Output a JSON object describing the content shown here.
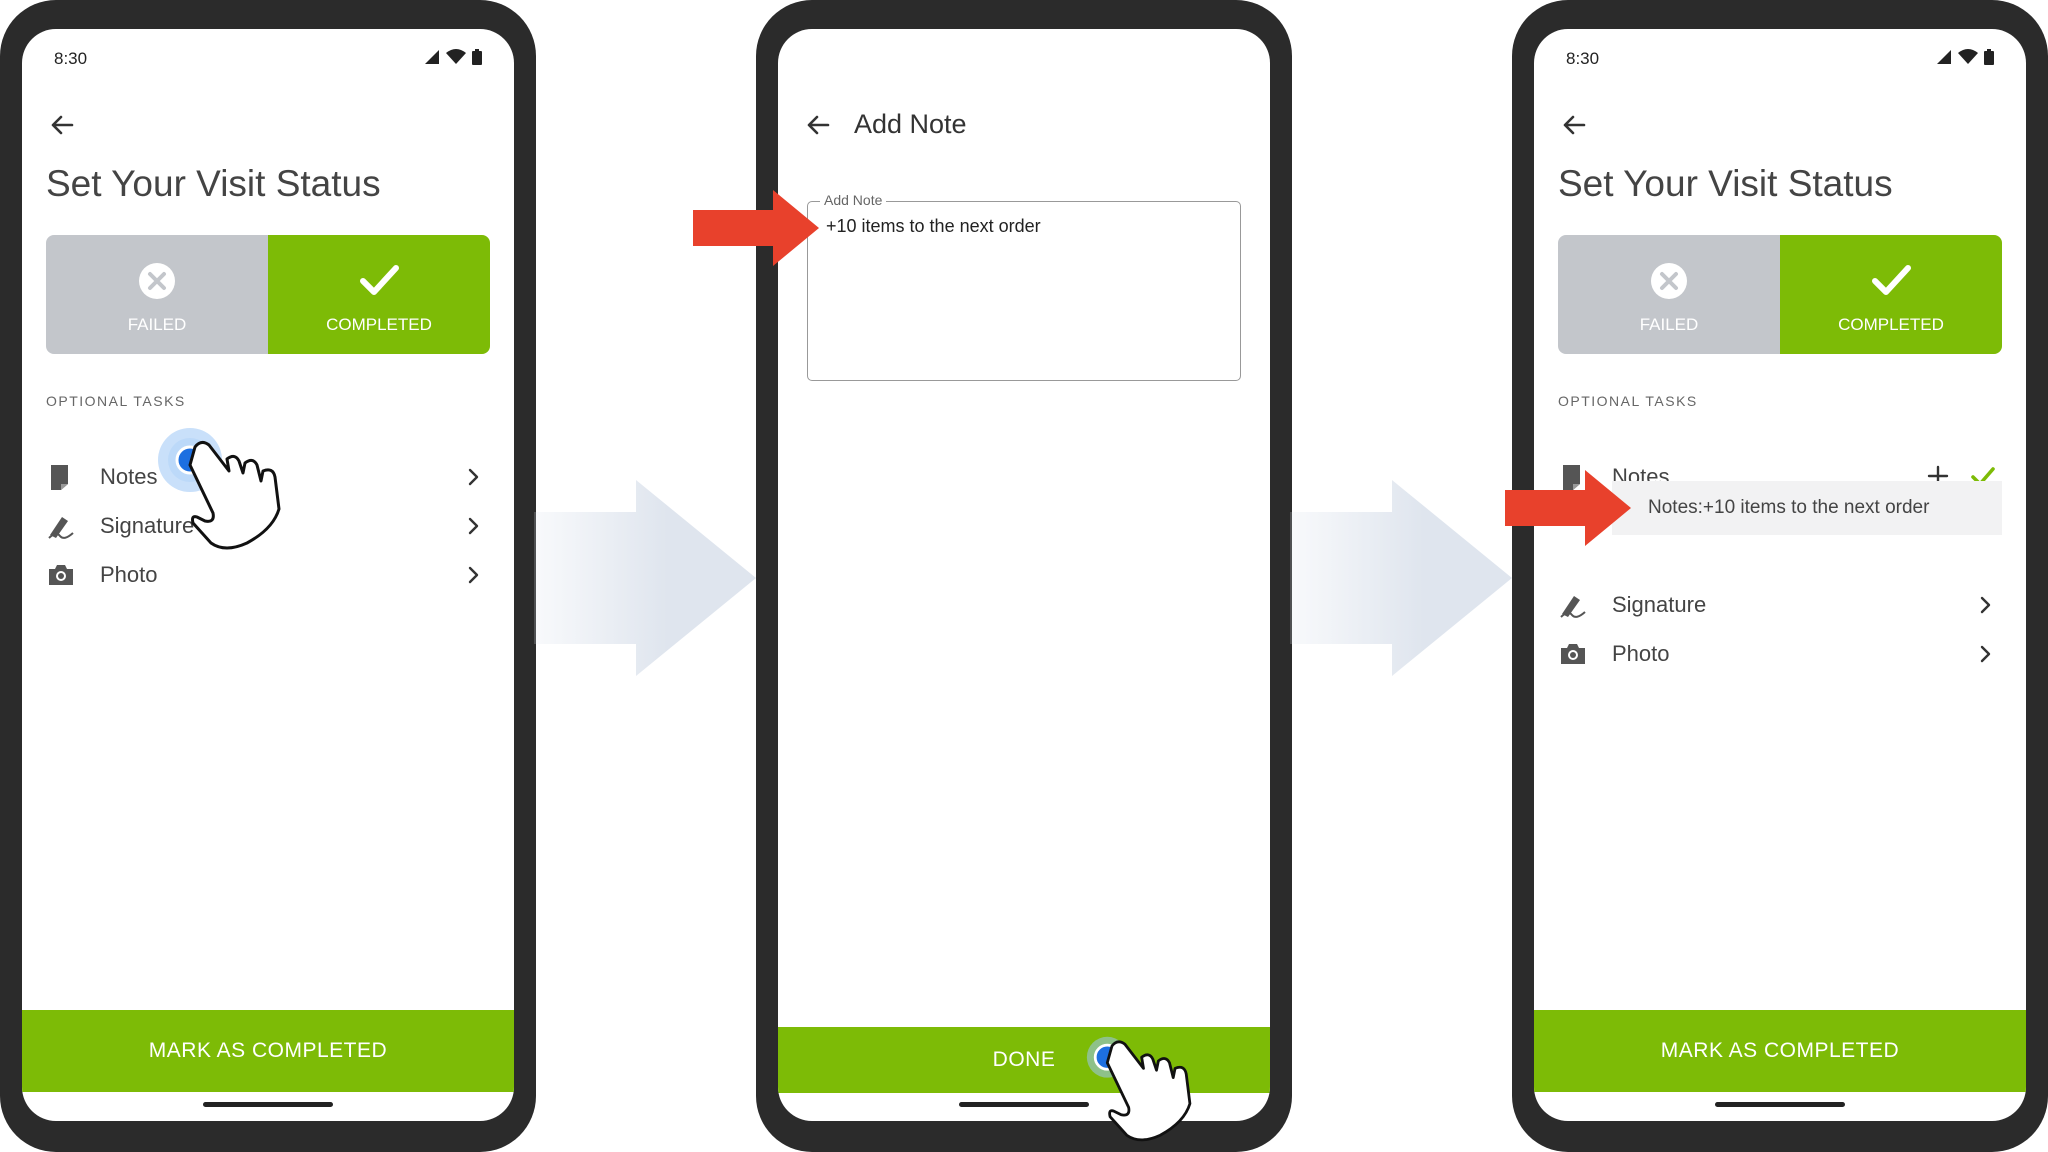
{
  "status_bar": {
    "time": "8:30"
  },
  "screen1": {
    "title": "Set Your Visit Status",
    "failed_label": "FAILED",
    "completed_label": "COMPLETED",
    "section_label": "OPTIONAL TASKS",
    "tasks": [
      {
        "label": "Notes",
        "icon": "note-icon"
      },
      {
        "label": "Signature",
        "icon": "signature-icon"
      },
      {
        "label": "Photo",
        "icon": "camera-icon"
      }
    ],
    "action_button": "MARK AS COMPLETED"
  },
  "screen2": {
    "title": "Add Note",
    "field_label": "Add Note",
    "field_value": "+10 items to the next order",
    "action_button": "DONE"
  },
  "screen3": {
    "title": "Set Your Visit Status",
    "failed_label": "FAILED",
    "completed_label": "COMPLETED",
    "section_label": "OPTIONAL TASKS",
    "tasks": [
      {
        "label": "Notes",
        "icon": "note-icon"
      },
      {
        "label": "Signature",
        "icon": "signature-icon"
      },
      {
        "label": "Photo",
        "icon": "camera-icon"
      }
    ],
    "note_text": "Notes:+10 items to the next order",
    "action_button": "MARK AS COMPLETED"
  },
  "colors": {
    "accent": "#7dbb06",
    "failed": "#c3c6cb",
    "callout": "#e8412c",
    "flow_arrow": "#dfe5ee"
  }
}
